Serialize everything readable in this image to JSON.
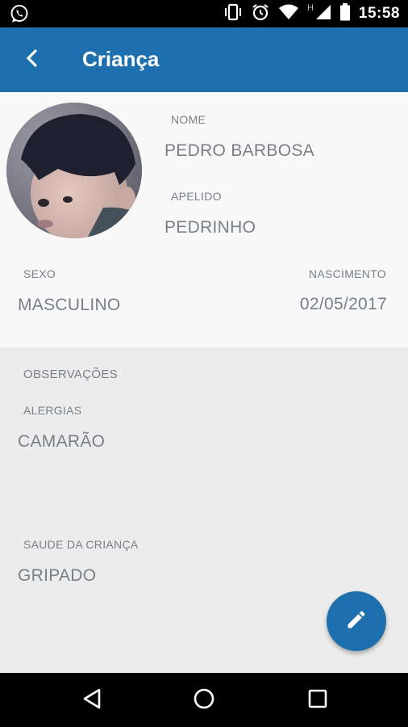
{
  "status_bar": {
    "time": "15:58",
    "signal_h": "H",
    "icons": [
      "whatsapp-icon",
      "vibrate-icon",
      "alarm-icon",
      "wifi-icon",
      "cell-signal-icon",
      "battery-icon"
    ]
  },
  "app_bar": {
    "title": "Criança",
    "back_icon": "back-arrow-icon",
    "color": "#1d6fae"
  },
  "profile": {
    "name_label": "NOME",
    "name_value": "PEDRO BARBOSA",
    "nickname_label": "APELIDO",
    "nickname_value": "PEDRINHO",
    "sex_label": "SEXO",
    "sex_value": "MASCULINO",
    "birth_label": "NASCIMENTO",
    "birth_value": "02/05/2017"
  },
  "details": {
    "observations_label": "OBSERVAÇÕES",
    "allergies_label": "ALERGIAS",
    "allergies_value": "CAMARÃO",
    "health_label": "SAUDE DA CRIANÇA",
    "health_value": "GRIPADO"
  },
  "fab": {
    "icon": "pencil-edit-icon"
  },
  "nav_bar": {
    "icons": [
      "nav-back-icon",
      "nav-home-icon",
      "nav-recents-icon"
    ]
  }
}
